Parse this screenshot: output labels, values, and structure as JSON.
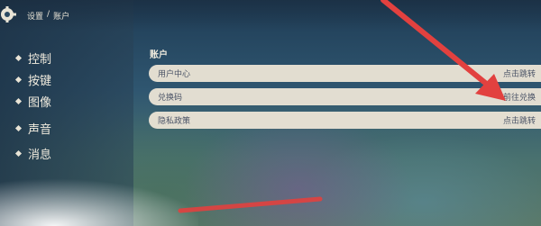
{
  "breadcrumb": {
    "settings": "设置",
    "separator": "/",
    "current": "账户"
  },
  "sidebar": {
    "items": [
      {
        "label": "控制"
      },
      {
        "label": "按键"
      },
      {
        "label": "图像"
      },
      {
        "label": "声音"
      },
      {
        "label": "消息"
      }
    ]
  },
  "main": {
    "section_title": "账户",
    "rows": [
      {
        "label": "用户中心",
        "action": "点击跳转"
      },
      {
        "label": "兑换码",
        "action": "前往兑换"
      },
      {
        "label": "隐私政策",
        "action": "点击跳转"
      }
    ]
  },
  "colors": {
    "annotation_arrow": "#e2413f",
    "row_bg": "#ece5d6",
    "text_light": "#f1ecdf"
  }
}
